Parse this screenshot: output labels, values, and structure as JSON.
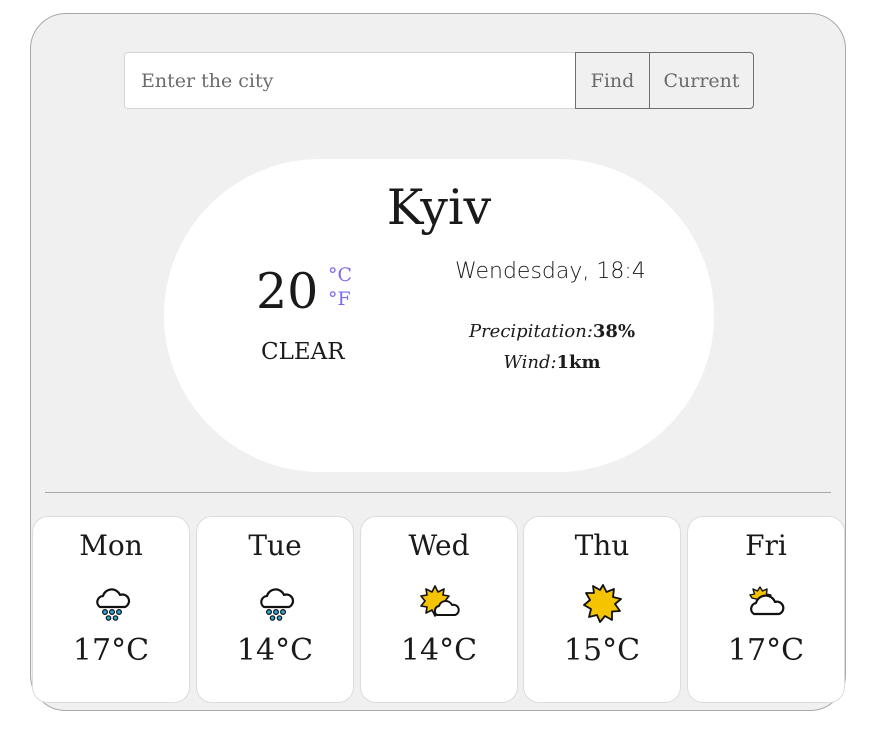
{
  "search": {
    "placeholder": "Enter the city",
    "find_label": "Find",
    "current_label": "Current"
  },
  "current": {
    "city": "Kyiv",
    "temperature": "20",
    "unit_c": "°C",
    "unit_f": "°F",
    "condition": "CLEAR",
    "datetime": "Wendesday, 18:4",
    "precipitation_label": "Precipitation:",
    "precipitation_value": "38%",
    "wind_label": "Wind:",
    "wind_value": "1km"
  },
  "forecast": [
    {
      "day": "Mon",
      "icon": "rain-cloud-icon",
      "temp": "17°C"
    },
    {
      "day": "Tue",
      "icon": "rain-cloud-icon",
      "temp": "14°C"
    },
    {
      "day": "Wed",
      "icon": "sun-cloud-icon",
      "temp": "14°C"
    },
    {
      "day": "Thu",
      "icon": "sun-icon",
      "temp": "15°C"
    },
    {
      "day": "Fri",
      "icon": "cloud-sun-icon",
      "temp": "17°C"
    }
  ],
  "colors": {
    "unit_accent": "#7b6cf0",
    "sun": "#f5c400",
    "rain": "#2aa7d6"
  }
}
